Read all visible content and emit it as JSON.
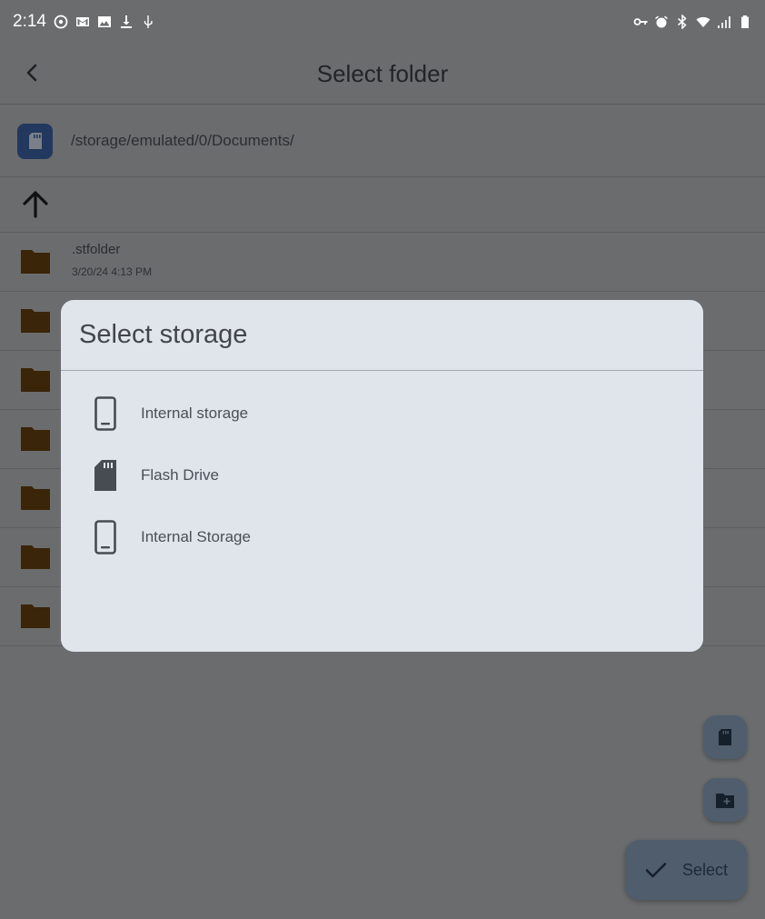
{
  "status_bar": {
    "time": "2:14",
    "left_icons": [
      "sync-icon",
      "gmail-icon",
      "gallery-icon",
      "download-icon",
      "usb-icon"
    ],
    "right_icons": [
      "vpn-key-icon",
      "alarm-icon",
      "bluetooth-icon",
      "wifi-icon",
      "signal-icon",
      "battery-icon"
    ]
  },
  "app_bar": {
    "title": "Select folder"
  },
  "path_bar": {
    "path": "/storage/emulated/0/Documents/"
  },
  "folders": [
    {
      "name": ".stfolder",
      "date": "3/20/24 4:13 PM"
    },
    {
      "name": "",
      "date": ""
    },
    {
      "name": "",
      "date": ""
    },
    {
      "name": "",
      "date": ""
    },
    {
      "name": "",
      "date": ""
    },
    {
      "name": "",
      "date": ""
    },
    {
      "name": "",
      "date": ""
    }
  ],
  "dialog": {
    "title": "Select storage",
    "items": [
      {
        "label": "Internal storage",
        "icon": "phone-icon"
      },
      {
        "label": "Flash Drive",
        "icon": "sd-card-icon"
      },
      {
        "label": "Internal Storage",
        "icon": "phone-icon"
      }
    ]
  },
  "fab": {
    "select_label": "Select"
  },
  "colors": {
    "scrim_background": "#6b6c6e",
    "dialog_background": "#e0e5ec",
    "folder_brown": "#3a2508",
    "fab_background": "#4f5d6c",
    "sd_badge": "#23385e"
  }
}
